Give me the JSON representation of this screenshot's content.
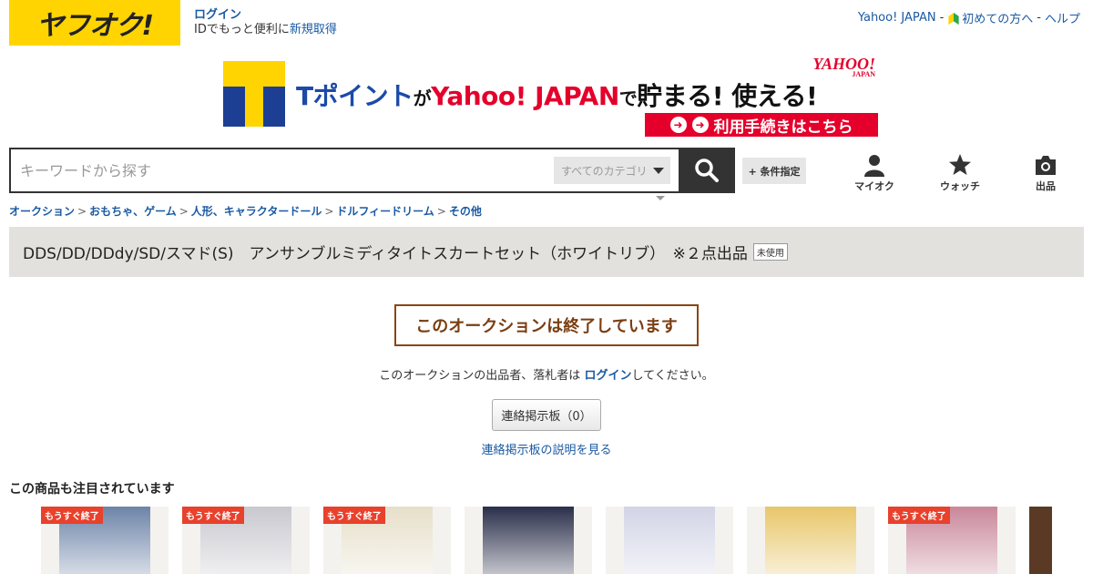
{
  "header": {
    "logo_text": "ヤフオク!",
    "login_link": "ログイン",
    "login_sub": "IDでもっと便利に",
    "signup_link": "新規取得",
    "top_links": {
      "yahoo_japan": "Yahoo! JAPAN",
      "sep1": "-",
      "first_time": "初めての方へ",
      "sep2": "-",
      "help": "ヘルプ"
    }
  },
  "banner": {
    "text_tpoint": "Tポイント",
    "text_ga": "が",
    "text_yahoo": "Yahoo! JAPAN",
    "text_de": "で",
    "text_tamaru": "貯まる! 使える!",
    "logo": "YAHOO!",
    "logo_sub": "JAPAN",
    "cta": "利用手続きはこちら"
  },
  "search": {
    "placeholder": "キーワードから探す",
    "category": "すべてのカテゴリ",
    "conditions": "+ 条件指定"
  },
  "nav": {
    "myauc": "マイオク",
    "watch": "ウォッチ",
    "sell": "出品"
  },
  "breadcrumb": [
    "オークション",
    "おもちゃ、ゲーム",
    "人形、キャラクタードール",
    "ドルフィードリーム",
    "その他"
  ],
  "breadcrumb_sep": ">",
  "item": {
    "title": "DDS/DD/DDdy/SD/スマド(S)　アンサンブルミディタイトスカートセット（ホワイトリブ）　※２点出品",
    "condition": "未使用"
  },
  "ended": {
    "status": "このオークションは終了しています",
    "msg_before": "このオークションの出品者、落札者は ",
    "msg_link": "ログイン",
    "msg_after": "してください。",
    "board_button": "連絡掲示板（0）",
    "board_help": "連絡掲示板の説明を見る"
  },
  "recommendations": {
    "title": "この商品も注目されています",
    "items": [
      {
        "tag": "もうすぐ終了",
        "color": "#6d84a8"
      },
      {
        "tag": "もうすぐ終了",
        "color": "#c8c8cf"
      },
      {
        "tag": "もうすぐ終了",
        "color": "#e6dfc9"
      },
      {
        "tag": "",
        "color": "#2a2f4a"
      },
      {
        "tag": "",
        "color": "#d2d4e6"
      },
      {
        "tag": "",
        "color": "#e8c66a"
      },
      {
        "tag": "もうすぐ終了",
        "color": "#c9879a"
      }
    ]
  },
  "colors": {
    "yahoo_yellow": "#ffd400",
    "link_blue": "#1a5aa3",
    "ended_brown": "#7a3e12",
    "tag_red": "#e8412c",
    "banner_red": "#e4002b"
  }
}
